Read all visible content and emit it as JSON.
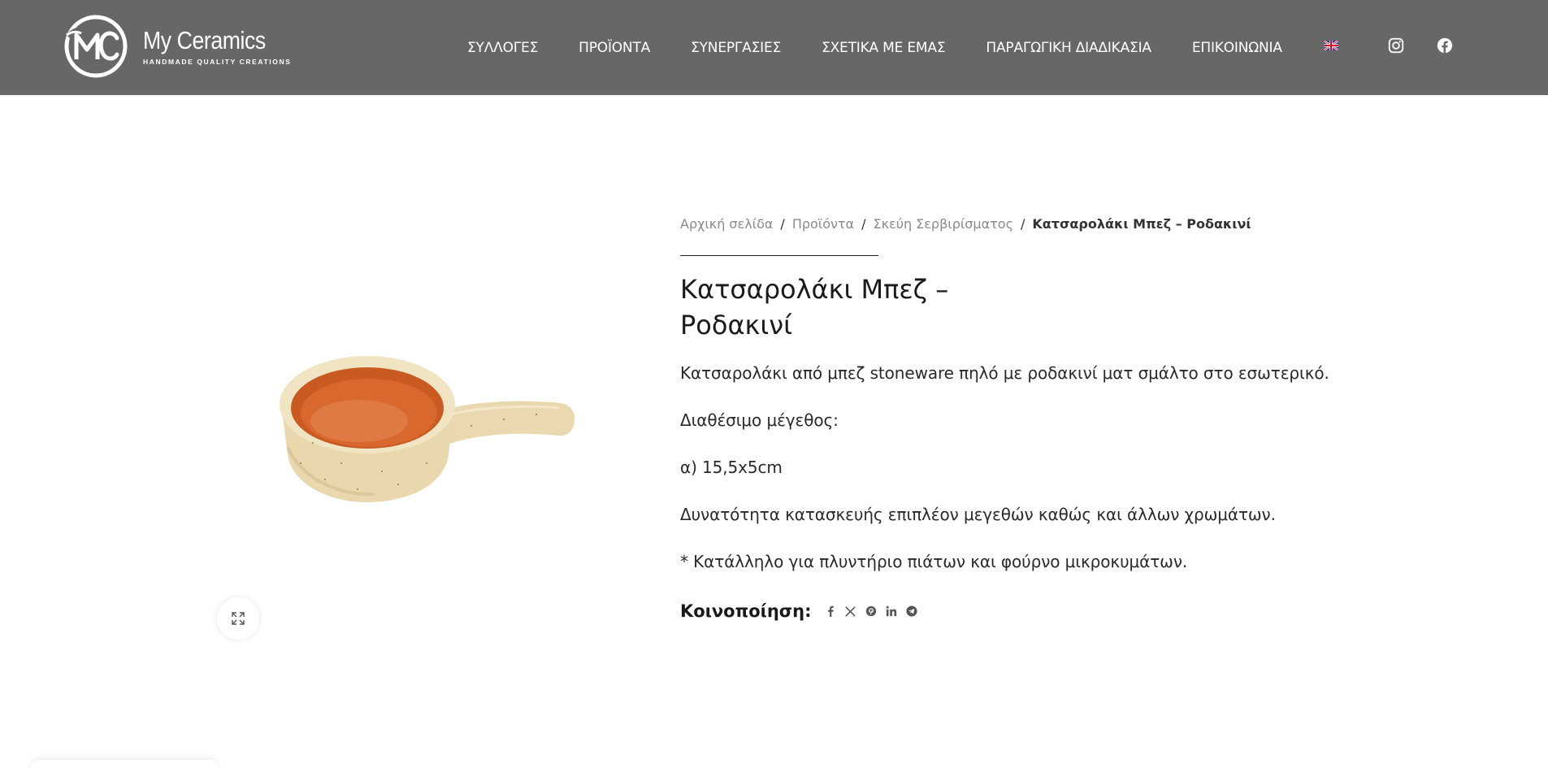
{
  "logo": {
    "initials": "MC",
    "name": "My Ceramics",
    "tagline": "HANDMADE QUALITY CREATIONS"
  },
  "nav": {
    "items": [
      {
        "label": "ΣΥΛΛΟΓΕΣ"
      },
      {
        "label": "ΠΡΟΪΟΝΤΑ"
      },
      {
        "label": "ΣΥΝΕΡΓΑΣΙΕΣ"
      },
      {
        "label": "ΣΧΕΤΙΚΑ ΜΕ ΕΜΑΣ"
      },
      {
        "label": "ΠΑΡΑΓΩΓΙΚΗ ΔΙΑΔΙΚΑΣΙΑ"
      },
      {
        "label": "ΕΠΙΚΟΙΝΩΝΙΑ"
      }
    ],
    "language_icon": "uk-flag-icon",
    "social_icons": [
      "instagram-icon",
      "facebook-icon"
    ]
  },
  "breadcrumb": {
    "items": [
      "Αρχική σελίδα",
      "Προϊόντα",
      "Σκεύη Σερβιρίσματος"
    ],
    "separator": "/",
    "current": "Κατσαρολάκι Μπεζ – Ροδακινί"
  },
  "product": {
    "title_line1": "Κατσαρολάκι Μπεζ –",
    "title_line2": "Ροδακινί",
    "description": [
      "Κατσαρολάκι από μπεζ stoneware πηλό με ροδακινί ματ σμάλτο στο εσωτερικό.",
      "Διαθέσιμο μέγεθος:",
      "α) 15,5x5cm",
      "Δυνατότητα κατασκευής επιπλέον μεγεθών καθώς και άλλων χρωμάτων.",
      "* Κατάλληλο για πλυντήριο πιάτων και φούρνο μικροκυμάτων."
    ],
    "image_icon": "ceramic-pan-image",
    "zoom_icon": "expand-icon"
  },
  "share": {
    "label": "Κοινοποίηση:",
    "icons": [
      "facebook-icon",
      "x-icon",
      "pinterest-icon",
      "linkedin-icon",
      "telegram-icon"
    ]
  },
  "colors": {
    "header_bg": "#676767",
    "pan_exterior": "#EDE1BE",
    "pan_interior": "#D9682E"
  }
}
